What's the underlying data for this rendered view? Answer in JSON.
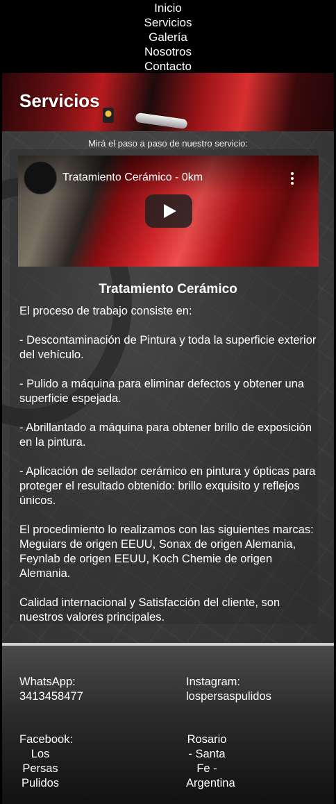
{
  "nav": {
    "items": [
      "Inicio",
      "Servicios",
      "Galería",
      "Nosotros",
      "Contacto"
    ]
  },
  "page": {
    "title": "Servicios",
    "subtitle": "Mirá el paso a paso de nuestro servicio:"
  },
  "video": {
    "title": "Tratamiento Cerámico - 0km",
    "icons": [
      "channel-avatar",
      "more-vert-icon",
      "play-button-icon"
    ]
  },
  "article": {
    "title": "Tratamiento Cerámico",
    "paragraphs": [
      "El proceso de trabajo consiste en:",
      "- Descontaminación de Pintura y toda la superficie exterior del vehículo.",
      "- Pulido a máquina para eliminar defectos y obtener una superficie espejada.",
      "- Abrillantado a máquina para obtener brillo de exposición en la pintura.",
      "- Aplicación de sellador cerámico en pintura y ópticas para proteger el resultado obtenido: brillo exquisito y reflejos únicos.",
      "El procedimiento lo realizamos con las siguientes marcas: Meguiars de origen EEUU, Sonax de origen Alemania, Feynlab de origen EEUU, Koch Chemie de origen Alemania.",
      "Calidad internacional y Satisfacción del cliente, son nuestros valores principales."
    ]
  },
  "footer": {
    "whatsapp_label": "WhatsApp:",
    "whatsapp_value": "3413458477",
    "instagram_label": "Instagram:",
    "instagram_value": "lospersaspulidos",
    "facebook_label": "Facebook:",
    "facebook_lines": [
      "Los",
      "Persas",
      "Pulidos"
    ],
    "location_lines": [
      "Rosario",
      "- Santa",
      "Fe -",
      "Argentina"
    ]
  },
  "colors": {
    "nav_bg": "#000000",
    "text": "#ffffff",
    "accent_red": "#c22024"
  }
}
